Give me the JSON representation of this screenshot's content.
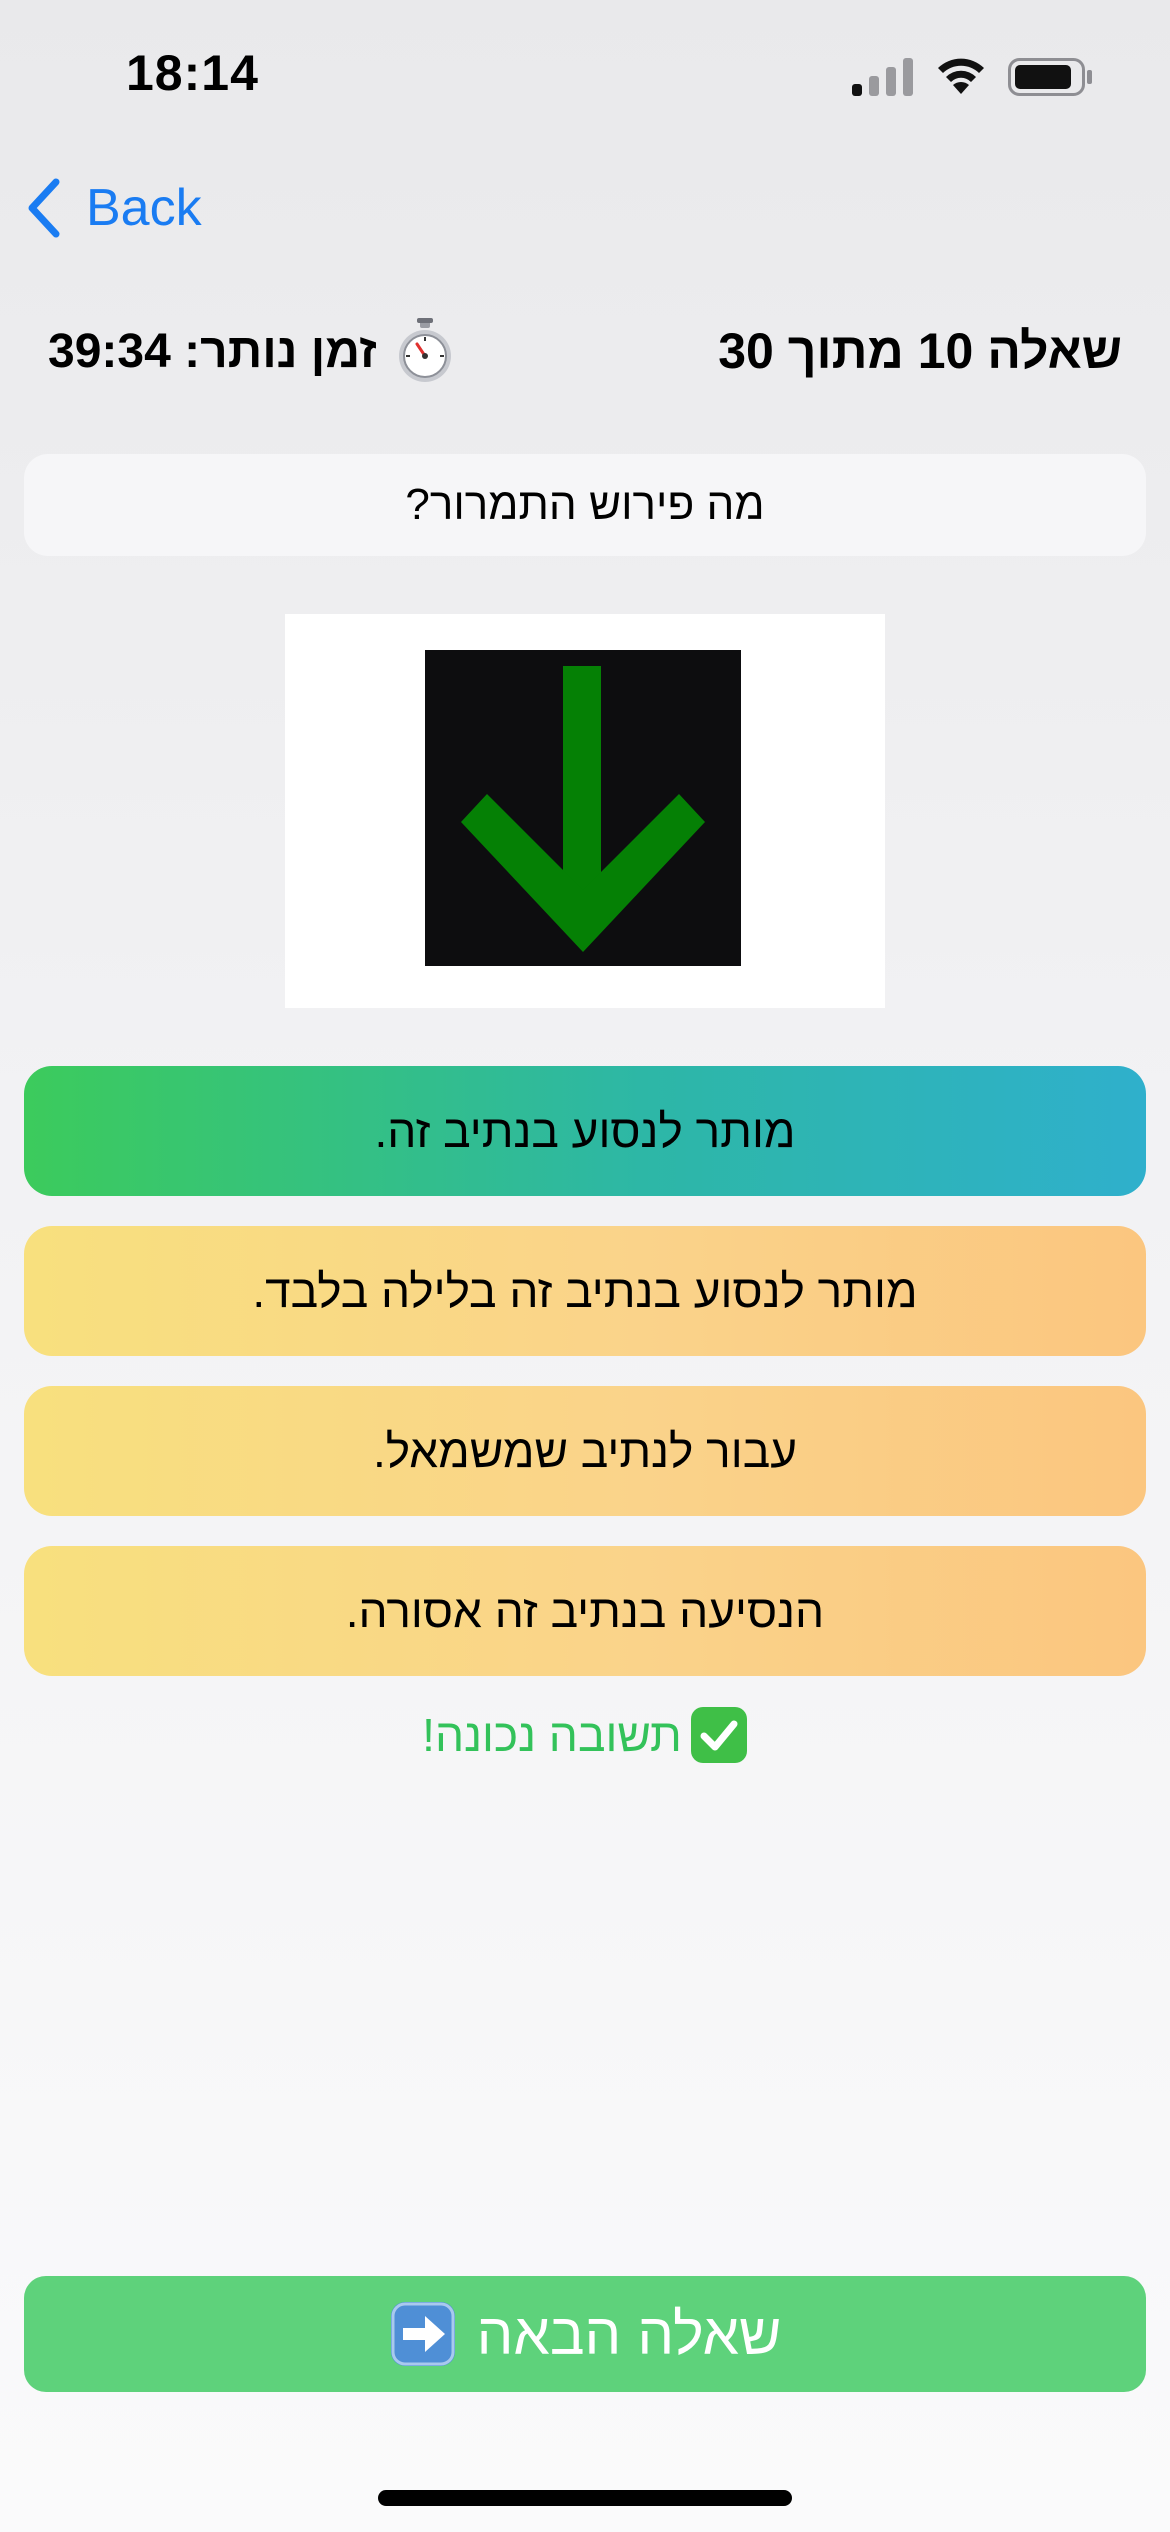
{
  "status_bar": {
    "time": "18:14"
  },
  "nav": {
    "back_label": "Back"
  },
  "header": {
    "timer_label": "זמן נותר:",
    "timer_value": "39:34",
    "question_counter": "שאלה 10 מתוך 30"
  },
  "question": {
    "prompt": "מה פירוש התמרור?"
  },
  "answers": [
    {
      "label": "מותר לנסוע בנתיב זה.",
      "state": "correct"
    },
    {
      "label": "מותר לנסוע בנתיב זה בלילה בלבד.",
      "state": "neutral"
    },
    {
      "label": "עבור לנתיב שמשמאל.",
      "state": "neutral"
    },
    {
      "label": "הנסיעה בנתיב זה אסורה.",
      "state": "neutral"
    }
  ],
  "feedback": {
    "text": "תשובה נכונה!",
    "icon": "check-mark-icon"
  },
  "next_button": {
    "label": "שאלה הבאה",
    "icon": "arrow-right-icon"
  },
  "colors": {
    "accent_blue": "#1a7cf2",
    "correct_green": "#3ccb5c",
    "correct_teal": "#2fb0cc",
    "neutral_yellow": "#f8e07e",
    "neutral_orange": "#fbc67f",
    "feedback_green": "#33c25a",
    "next_button_green": "#5ed27b",
    "sign_arrow_green": "#058005"
  }
}
